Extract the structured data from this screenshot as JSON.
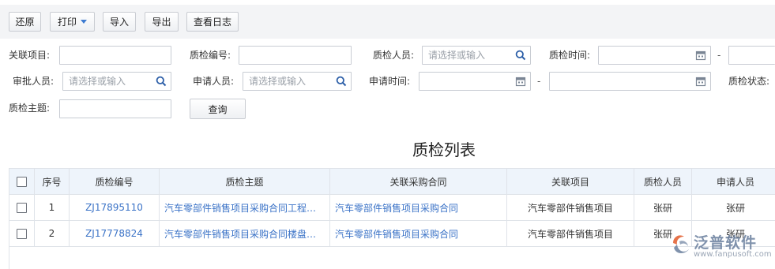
{
  "toolbar": {
    "restore": "还原",
    "print": "打印",
    "import": "导入",
    "export": "导出",
    "view_log": "查看日志"
  },
  "filters": {
    "project_label": "关联项目:",
    "code_label": "质检编号:",
    "inspector_label": "质检人员:",
    "inspector_placeholder": "请选择或输入",
    "time_label": "质检时间:",
    "approver_label": "审批人员:",
    "approver_placeholder": "请选择或输入",
    "applicant_label": "申请人员:",
    "applicant_placeholder": "请选择或输入",
    "apply_time_label": "申请时间:",
    "status_label": "质检状态:",
    "subject_label": "质检主题:",
    "range_sep": "-",
    "query_button": "查询"
  },
  "table": {
    "title": "质检列表",
    "columns": [
      "序号",
      "质检编号",
      "质检主题",
      "关联采购合同",
      "关联项目",
      "质检人员",
      "申请人员"
    ],
    "rows": [
      [
        "1",
        "ZJ17895110",
        "汽车零部件销售项目采购合同工程车辆用件采购质检",
        "汽车零部件销售项目采购合同",
        "汽车零部件销售项目",
        "张研",
        "张研"
      ],
      [
        "2",
        "ZJ17778824",
        "汽车零部件销售项目采购合同楼盘车辆用件采购质检",
        "汽车零部件销售项目采购合同",
        "汽车零部件销售项目",
        "张研",
        "张研"
      ]
    ]
  },
  "watermark": {
    "brand": "泛普软件",
    "url": "www.fanpusoft.com"
  },
  "colors": {
    "link": "#3b73c7",
    "header_bg": "#eef4fb",
    "toolbar_bg": "#f3f4f6",
    "accent": "#3d7bd1"
  },
  "icons": {
    "search": "search-icon",
    "calendar": "calendar-icon",
    "dropdown": "caret-down-icon",
    "checkbox": "checkbox"
  }
}
